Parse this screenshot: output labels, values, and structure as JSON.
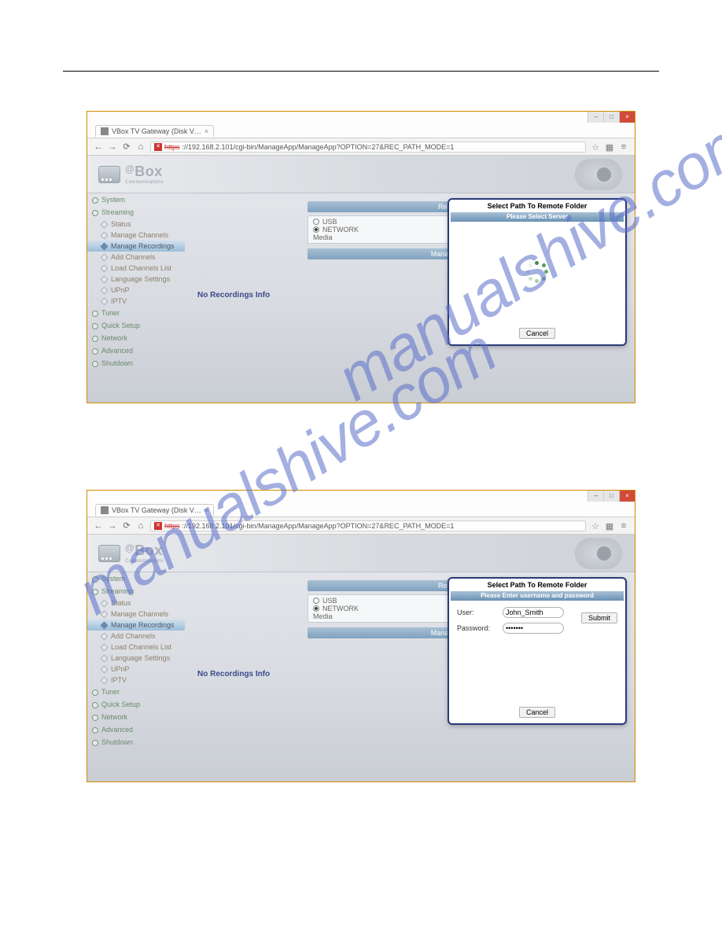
{
  "watermark": "manualshive.com",
  "browser": {
    "tab_title": "VBox TV Gateway (Disk V…",
    "url_prefix": "https",
    "url_rest": "://192.168.2.101/cgi-bin/ManageApp/ManageApp?OPTION=27&REC_PATH_MODE=1",
    "win_min": "–",
    "win_max": "□",
    "win_close": "×",
    "star": "☆",
    "ext": "▦",
    "menu": "≡",
    "back": "←",
    "fwd": "→",
    "reload": "⟳",
    "home": "⌂",
    "warn": "✕"
  },
  "logo": {
    "at": "@",
    "brand": "Box",
    "sub": "Communications"
  },
  "nav": {
    "system": "System",
    "streaming": "Streaming",
    "status": "Status",
    "manage_channels": "Manage Channels",
    "manage_recordings": "Manage Recordings",
    "add_channels": "Add Channels",
    "load_channels_list": "Load Channels List",
    "language_settings": "Language Settings",
    "upnp": "UPnP",
    "iptv": "IPTV",
    "tuner": "Tuner",
    "quick_setup": "Quick Setup",
    "network": "Network",
    "advanced": "Advanced",
    "shutdown": "Shutdown"
  },
  "main": {
    "recording_path": "Recording Path",
    "usb": "USB",
    "network": "NETWORK",
    "media": "Media",
    "manage_recordings_bar": "Manage Recordings",
    "no_rec": "No Recordings Info"
  },
  "modal1": {
    "title": "Select Path To Remote Folder",
    "bar": "Please Select Server",
    "cancel": "Cancel"
  },
  "modal2": {
    "title": "Select Path To Remote Folder",
    "bar": "Please Enter username and password",
    "user_label": "User:",
    "user_value": "John_Smith",
    "pass_label": "Password:",
    "pass_value": "•••••••",
    "submit": "Submit",
    "cancel": "Cancel"
  }
}
